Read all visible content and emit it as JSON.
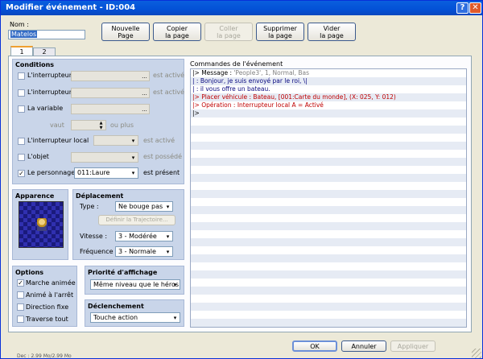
{
  "title": "Modifier événement - ID:004",
  "help_glyph": "?",
  "close_glyph": "✕",
  "name_label": "Nom :",
  "name_value": "Matelos",
  "toolbar": {
    "new_page_1": "Nouvelle",
    "new_page_2": "Page",
    "copy_1": "Copier",
    "copy_2": "la page",
    "paste_1": "Coller",
    "paste_2": "la page",
    "delete_1": "Supprimer",
    "delete_2": "la page",
    "clear_1": "Vider",
    "clear_2": "la page"
  },
  "tabs": [
    "1",
    "2"
  ],
  "conditions": {
    "title": "Conditions",
    "switch1": "L'interrupteur",
    "switch1_suffix": "est activé",
    "switch2": "L'interrupteur",
    "switch2_suffix": "est activé",
    "variable": "La variable",
    "value_label": "vaut",
    "value_suffix": "ou plus",
    "local_switch": "L'interrupteur local",
    "local_suffix": "est activé",
    "item": "L'objet",
    "item_suffix": "est possédé",
    "actor": "Le personnage",
    "actor_value": "011:Laure",
    "actor_suffix": "est présent",
    "ellipsis": "..."
  },
  "appearance": {
    "title": "Apparence"
  },
  "movement": {
    "title": "Déplacement",
    "type_label": "Type :",
    "type_value": "Ne bouge pas",
    "define_route": "Définir la Trajectoire...",
    "speed_label": "Vitesse :",
    "speed_value": "3 - Modérée",
    "freq_label": "Fréquence :",
    "freq_value": "3 - Normale"
  },
  "options": {
    "title": "Options",
    "walk": "Marche animée",
    "stop": "Animé à l'arrêt",
    "dirfix": "Direction fixe",
    "through": "Traverse tout"
  },
  "priority": {
    "title": "Priorité d'affichage",
    "value": "Même niveau que le héros"
  },
  "trigger": {
    "title": "Déclenchement",
    "value": "Touche action"
  },
  "commands": {
    "title": "Commandes de l'événement",
    "lines": [
      {
        "text": "|> Message : ",
        "extra": "'People3', 1, Normal, Bas",
        "color": "#000000",
        "extra_color": "#808080"
      },
      {
        "text": "|              : Bonjour, je suis envoyé par le roi, \\|",
        "extra": "",
        "color": "#0a0a80",
        "extra_color": "#808080"
      },
      {
        "text": "|              : il vous offre un bateau.",
        "extra": "",
        "color": "#0a0a80",
        "extra_color": "#808080"
      },
      {
        "text": "|> Placer véhicule : Bateau, [001:Carte du monde], (X: 025, Y: 012)",
        "extra": "",
        "color": "#c00000",
        "extra_color": "#808080"
      },
      {
        "text": "|> Opération : Interrupteur local A = Activé",
        "extra": "",
        "color": "#c00000",
        "extra_color": "#808080"
      },
      {
        "text": "|>",
        "extra": "",
        "color": "#000000",
        "extra_color": "#808080"
      }
    ]
  },
  "footer": {
    "ok": "OK",
    "cancel": "Annuler",
    "apply": "Appliquer"
  },
  "status": {
    "memory": "Dec : 2.99 Mo/2.99 Mo"
  }
}
